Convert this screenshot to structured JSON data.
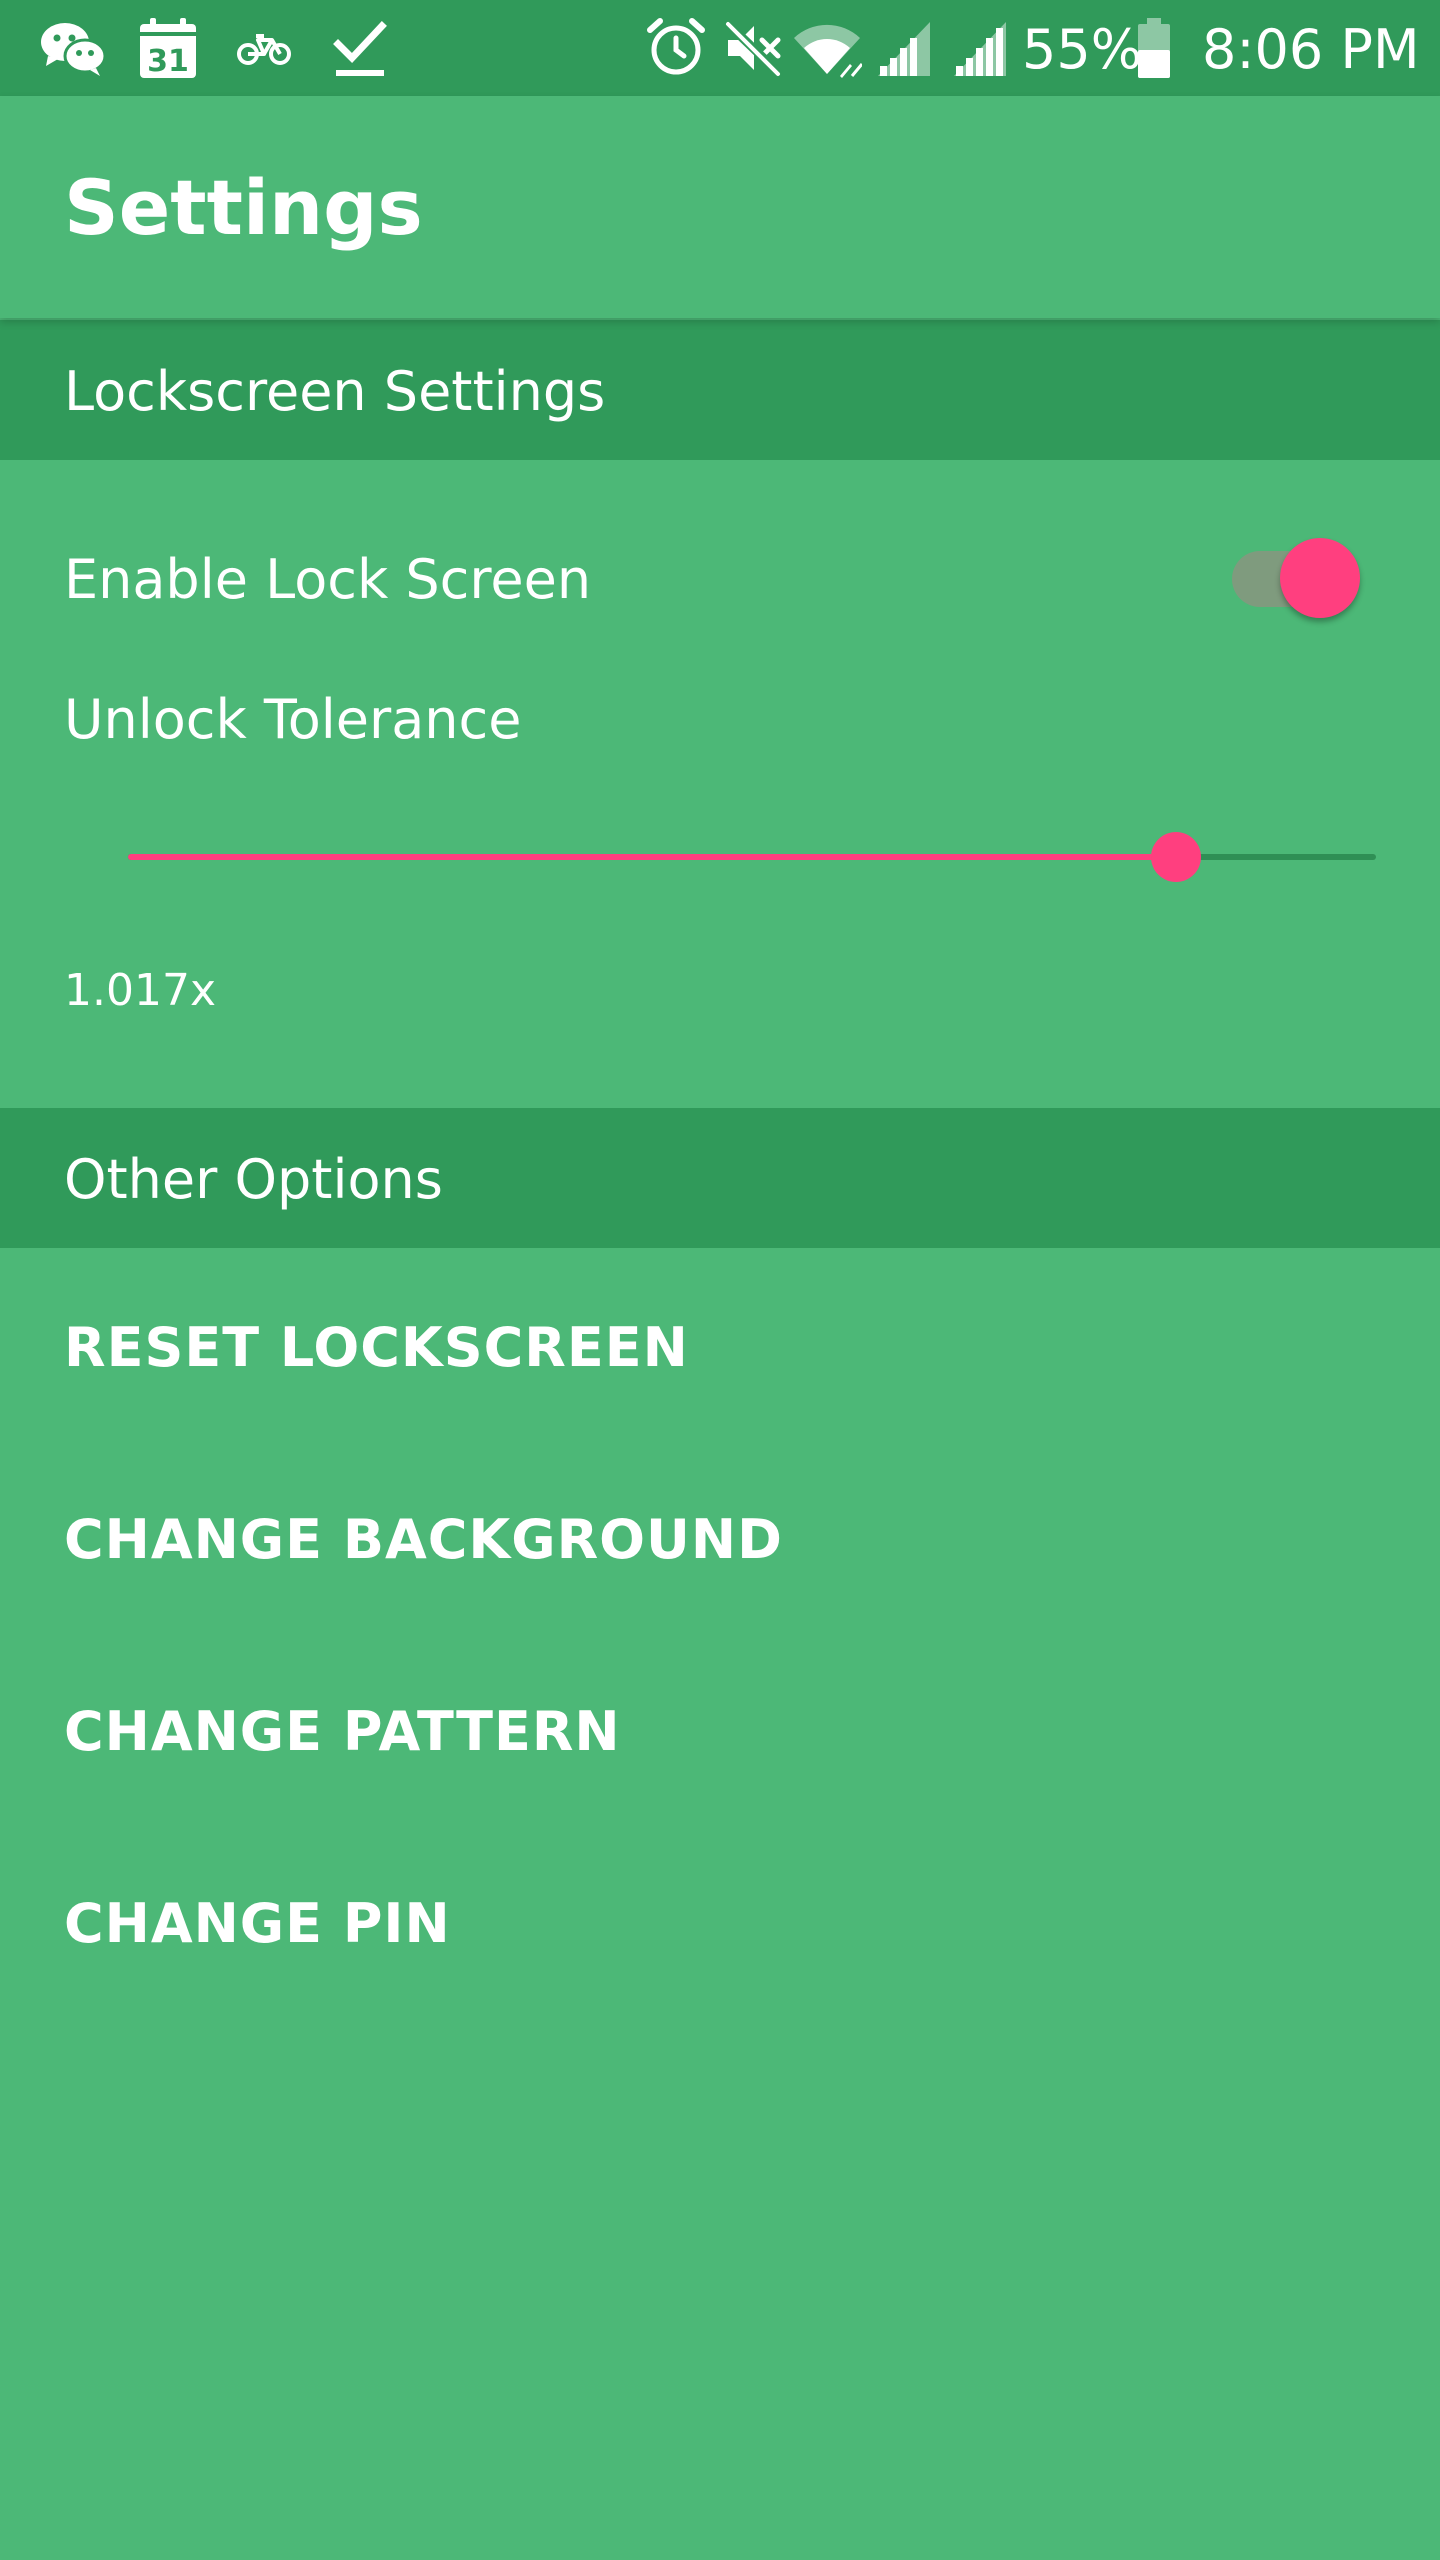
{
  "status_bar": {
    "battery_percent": "55%",
    "time": "8:06 PM",
    "calendar_day": "31",
    "icons_left": [
      "wechat-icon",
      "calendar-icon",
      "bike-icon",
      "download-check-icon"
    ],
    "icons_right": [
      "alarm-icon",
      "mute-icon",
      "wifi-icon",
      "signal-icon",
      "signal-icon",
      "battery-icon"
    ]
  },
  "app_bar": {
    "title": "Settings"
  },
  "sections": {
    "lockscreen": {
      "header": "Lockscreen Settings",
      "enable_lock_label": "Enable Lock Screen",
      "enable_lock_on": true,
      "tolerance_label": "Unlock Tolerance",
      "tolerance_value_text": "1.017x",
      "tolerance_slider_fraction": 0.84
    },
    "other": {
      "header": "Other Options",
      "buttons": [
        "RESET LOCKSCREEN",
        "CHANGE BACKGROUND",
        "CHANGE PATTERN",
        "CHANGE PIN"
      ]
    }
  },
  "colors": {
    "background": "#4cb877",
    "section_header": "#309a5a",
    "accent": "#ff3f7f",
    "toggle_track": "#7f9b7e",
    "slider_rest_track": "#2f8f55"
  }
}
